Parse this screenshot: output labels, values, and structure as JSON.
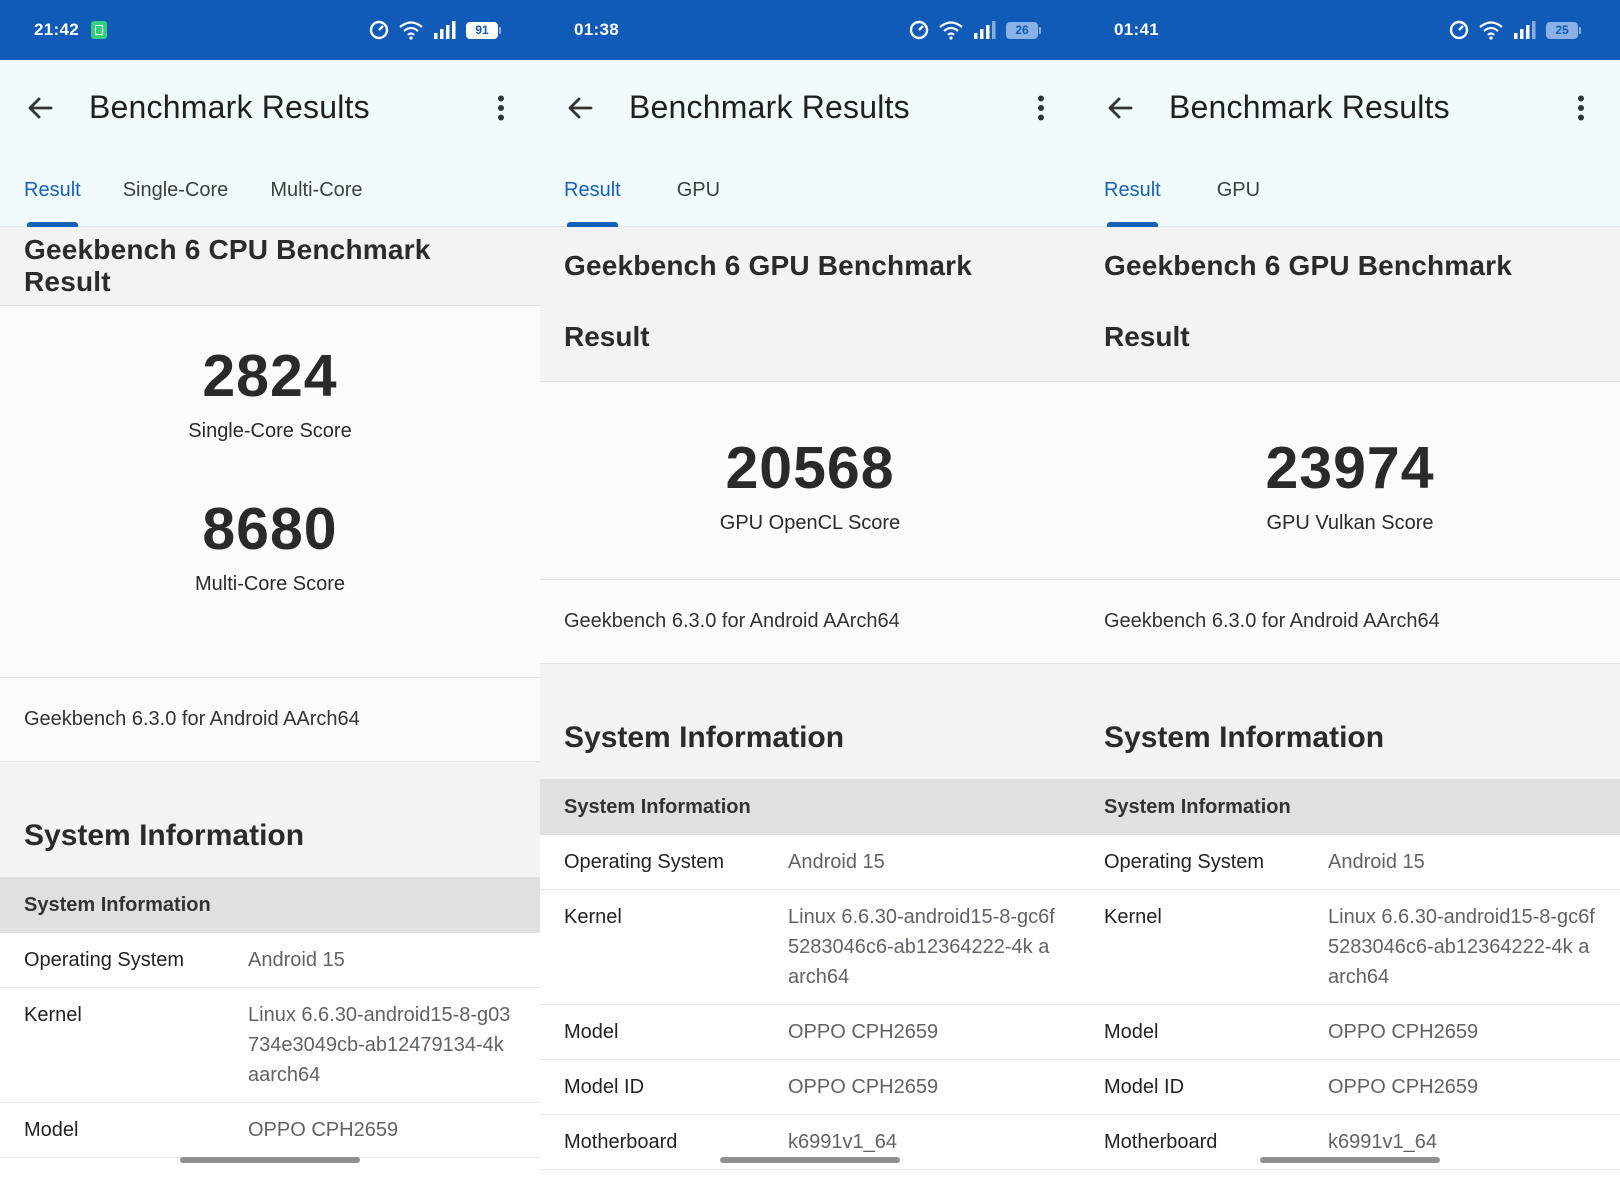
{
  "app_title": "Benchmark Results",
  "version_text": "Geekbench 6.3.0 for Android AArch64",
  "sysinfo_title": "System Information",
  "sysinfo_subheader": "System Information",
  "phones": [
    {
      "status": {
        "time": "21:42",
        "battery": "91"
      },
      "tabs": [
        "Result",
        "Single-Core",
        "Multi-Core"
      ],
      "header": "Geekbench 6 CPU Benchmark Result",
      "scores": [
        {
          "value": "2824",
          "label": "Single-Core Score"
        },
        {
          "value": "8680",
          "label": "Multi-Core Score"
        }
      ],
      "info_rows": [
        {
          "key": "Operating System",
          "value": "Android 15"
        },
        {
          "key": "Kernel",
          "value": "Linux 6.6.30-android15-8-g03734e3049cb-ab12479134-4k aarch64"
        },
        {
          "key": "Model",
          "value": "OPPO CPH2659"
        }
      ]
    },
    {
      "status": {
        "time": "01:38",
        "battery": "26"
      },
      "tabs": [
        "Result",
        "GPU"
      ],
      "header_line1": "Geekbench 6 GPU Benchmark",
      "header_line2": "Result",
      "scores": [
        {
          "value": "20568",
          "label": "GPU OpenCL Score"
        }
      ],
      "info_rows": [
        {
          "key": "Operating System",
          "value": "Android 15"
        },
        {
          "key": "Kernel",
          "value": "Linux 6.6.30-android15-8-gc6f5283046c6-ab12364222-4k aarch64"
        },
        {
          "key": "Model",
          "value": "OPPO CPH2659"
        },
        {
          "key": "Model ID",
          "value": "OPPO CPH2659"
        },
        {
          "key": "Motherboard",
          "value": "k6991v1_64"
        }
      ]
    },
    {
      "status": {
        "time": "01:41",
        "battery": "25"
      },
      "tabs": [
        "Result",
        "GPU"
      ],
      "header_line1": "Geekbench 6 GPU Benchmark",
      "header_line2": "Result",
      "scores": [
        {
          "value": "23974",
          "label": "GPU Vulkan Score"
        }
      ],
      "info_rows": [
        {
          "key": "Operating System",
          "value": "Android 15"
        },
        {
          "key": "Kernel",
          "value": "Linux 6.6.30-android15-8-gc6f5283046c6-ab12364222-4k aarch64"
        },
        {
          "key": "Model",
          "value": "OPPO CPH2659"
        },
        {
          "key": "Model ID",
          "value": "OPPO CPH2659"
        },
        {
          "key": "Motherboard",
          "value": "k6991v1_64"
        }
      ]
    }
  ],
  "icons": {
    "back": "arrow-back-icon",
    "more": "more-vert-icon",
    "data_saver": "data-saver-icon",
    "wifi": "wifi-icon",
    "signal": "signal-icon",
    "battery": "battery-icon",
    "notification": "notification-icon"
  },
  "colors": {
    "status_bar": "#0f5bb7",
    "app_bar": "#f1fbfe",
    "accent": "#1561b8"
  }
}
